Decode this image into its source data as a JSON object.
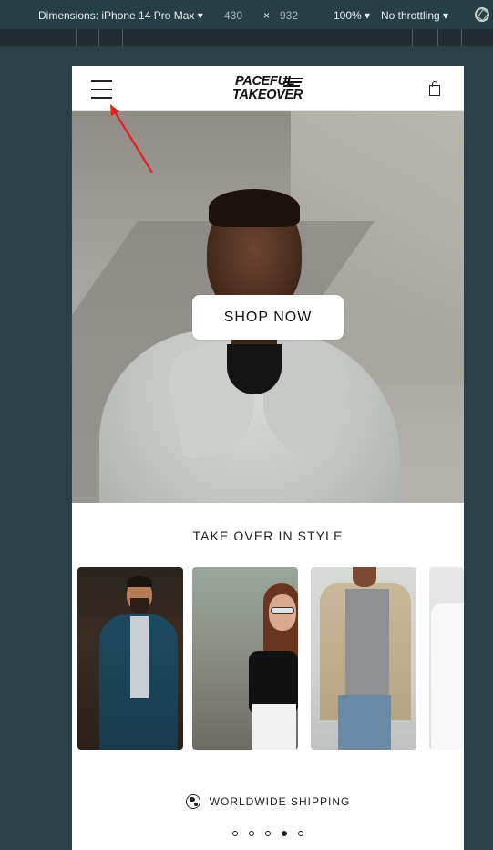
{
  "devtools": {
    "dimensions_label": "Dimensions: iPhone 14 Pro Max",
    "width": "430",
    "times": "×",
    "height": "932",
    "zoom": "100%",
    "throttling": "No throttling",
    "dropdown_icon": "caret-down-icon",
    "rotate_icon": "rotate-icon"
  },
  "header": {
    "menu_icon": "hamburger-menu-icon",
    "logo_line1": "PACEFUL",
    "logo_line2": "TAKEOVER",
    "cart_icon": "shopping-bag-icon"
  },
  "hero": {
    "button_label": "SHOP NOW"
  },
  "section": {
    "title": "TAKE OVER IN STYLE",
    "cards": [
      {
        "name": "man-in-blue-suit"
      },
      {
        "name": "woman-with-sunglasses"
      },
      {
        "name": "man-in-cardigan"
      },
      {
        "name": "partial-card"
      }
    ]
  },
  "shipping": {
    "icon": "globe-icon",
    "label": "WORLDWIDE SHIPPING"
  },
  "pagination": {
    "count": 5,
    "active_index": 3
  },
  "annotation": {
    "color": "#e3201c"
  },
  "colors": {
    "devtools_bg": "#263f46",
    "page_bg": "#2b4048",
    "text": "#222222"
  }
}
